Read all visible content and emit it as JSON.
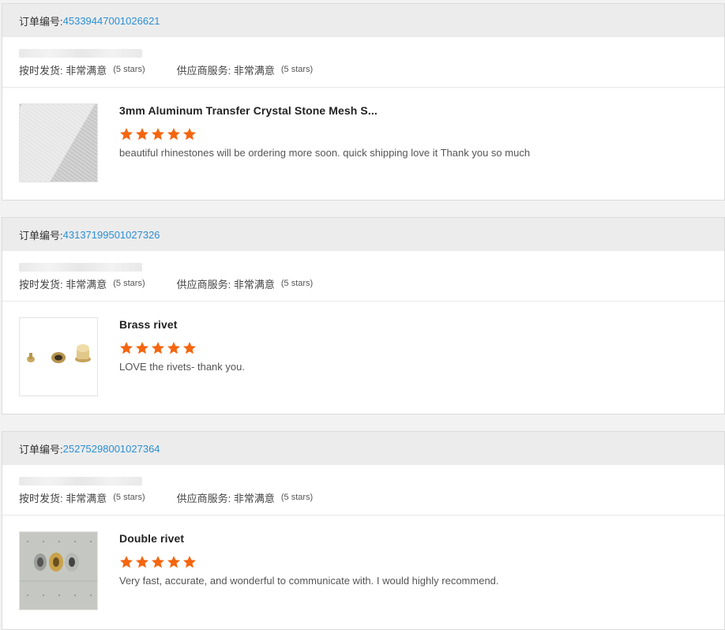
{
  "labels": {
    "order_no": "订单编号:",
    "on_time": "按时发货:",
    "supplier": "供应商服务:",
    "rating_text": "非常满意",
    "stars_note": "(5 stars)"
  },
  "colors": {
    "link": "#2a8fd6",
    "star": "#f5650f",
    "header_bg": "#ececec"
  },
  "orders": [
    {
      "order_number": "45339447001026621",
      "product_title": "3mm Aluminum Transfer Crystal Stone Mesh S...",
      "rating": 5,
      "review": "beautiful rhinestones will be ordering more soon. quick shipping love it Thank you so much",
      "thumbnail": "mesh-fabric-image"
    },
    {
      "order_number": "43137199501027326",
      "product_title": "Brass rivet",
      "rating": 5,
      "review": "LOVE the rivets- thank you.",
      "thumbnail": "brass-rivet-image"
    },
    {
      "order_number": "25275298001027364",
      "product_title": "Double rivet",
      "rating": 5,
      "review": "Very fast, accurate, and wonderful to communicate with.  I would highly recommend.",
      "thumbnail": "double-rivet-image"
    }
  ]
}
